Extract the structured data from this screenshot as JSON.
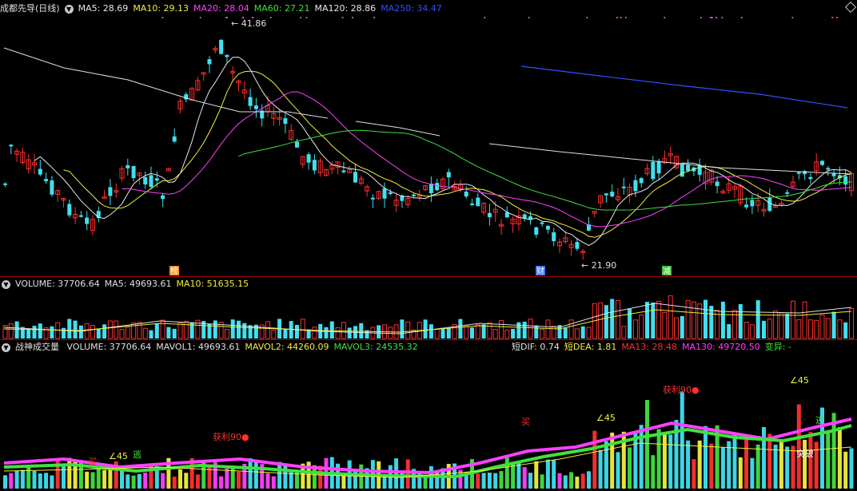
{
  "main": {
    "title": "成都先导(日线)",
    "indicators": [
      {
        "label": "MA5: 28.69",
        "color": "#e8e8e8"
      },
      {
        "label": "MA10: 29.13",
        "color": "#f0f040"
      },
      {
        "label": "MA20: 28.04",
        "color": "#ff40ff"
      },
      {
        "label": "MA60: 27.21",
        "color": "#40e040"
      },
      {
        "label": "MA120: 28.86",
        "color": "#e8e8e8"
      },
      {
        "label": "MA250: 34.47",
        "color": "#3050ff"
      }
    ],
    "high_label": "41.86",
    "low_label": "21.90",
    "markers": [
      "榜",
      "财",
      "减"
    ]
  },
  "volume": {
    "items": [
      {
        "label": "VOLUME: 37706.64",
        "color": "#e0e0e0"
      },
      {
        "label": "MA5: 49693.61",
        "color": "#e0e0e0"
      },
      {
        "label": "MA10: 51635.15",
        "color": "#f0f040"
      }
    ]
  },
  "indicator": {
    "title": "战神成交量",
    "items": [
      {
        "label": "VOLUME: 37706.64",
        "color": "#e0e0e0"
      },
      {
        "label": "MAVOL1: 49693.61",
        "color": "#e0e0e0"
      },
      {
        "label": "MAVOL2: 44260.09",
        "color": "#f0f040"
      },
      {
        "label": "MAVOL3: 24535.32",
        "color": "#40e040"
      }
    ],
    "right_items": [
      {
        "label": "短DIF: 0.74",
        "color": "#e0e0e0"
      },
      {
        "label": "短DEA: 1.81",
        "color": "#f0f040"
      },
      {
        "label": "MA13: 28.48",
        "color": "#ff3030"
      },
      {
        "label": "MA130: 49720.50",
        "color": "#ff40ff"
      },
      {
        "label": "变异: -",
        "color": "#40e040"
      }
    ],
    "annotations": [
      {
        "text": "买",
        "color": "#ff3030"
      },
      {
        "text": "∠45",
        "color": "#f0f040"
      },
      {
        "text": "逃",
        "color": "#40e040"
      },
      {
        "text": "获利90●",
        "color": "#ff3030"
      },
      {
        "text": "买",
        "color": "#ff3030"
      },
      {
        "text": "∠45",
        "color": "#f0f040"
      },
      {
        "text": "获利90●",
        "color": "#ff3030"
      },
      {
        "text": "∠45",
        "color": "#f0f040"
      },
      {
        "text": "突破",
        "color": "#ffffff"
      },
      {
        "text": "逃",
        "color": "#40e040"
      }
    ]
  }
}
